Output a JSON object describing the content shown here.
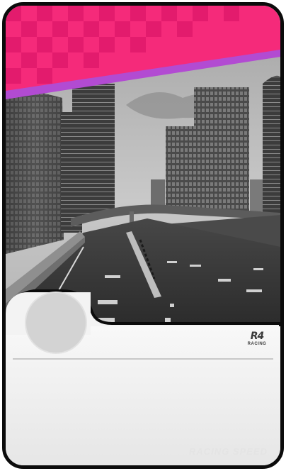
{
  "card": {
    "header_banner": {
      "color": "#f52a7a",
      "stripe_color": "#b24bd2",
      "pattern": "checkered-flag"
    },
    "photo": {
      "subject": "city-highway-overpass",
      "tone": "grayscale"
    },
    "avatar": {
      "color": "#d3d3d3"
    },
    "logo": {
      "main_text": "R4",
      "sub_text": "RACING"
    },
    "watermark": {
      "text": "RACING SPEED"
    }
  }
}
